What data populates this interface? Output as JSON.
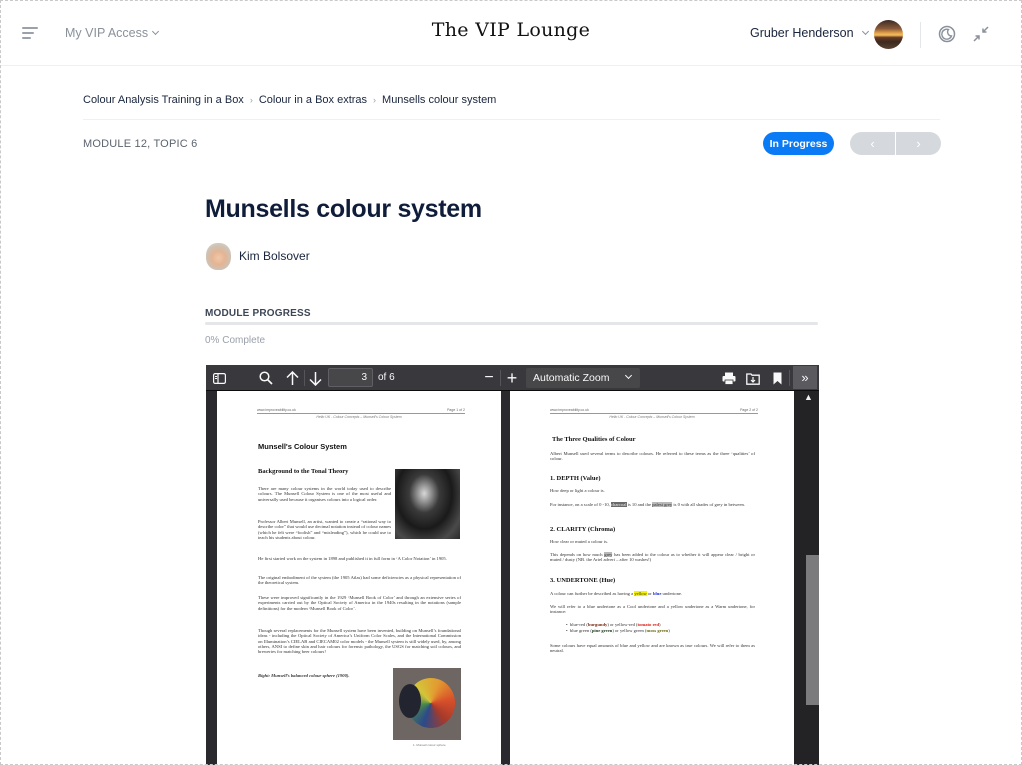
{
  "header": {
    "menu_icon": "hamburger-menu-icon",
    "vip_access_label": "My VIP Access",
    "brand": "The VIP Lounge",
    "user_name": "Gruber Henderson",
    "theme_icon": "moon-icon",
    "collapse_icon": "collapse-arrows-icon"
  },
  "breadcrumb": [
    {
      "label": "Colour Analysis Training in a Box"
    },
    {
      "label": "Colour in a Box extras"
    },
    {
      "label": "Munsells colour system"
    }
  ],
  "breadcrumb_separator": "›",
  "module_topic": "MODULE 12, TOPIC 6",
  "status": {
    "label": "In Progress",
    "color": "#0a7bf5"
  },
  "pager": {
    "prev": "‹",
    "next": "›"
  },
  "page": {
    "title": "Munsells colour system",
    "author": "Kim Bolsover"
  },
  "progress": {
    "label": "MODULE PROGRESS",
    "percent": 0,
    "text": "0% Complete"
  },
  "pdf_viewer": {
    "toolbar": {
      "sidebar_icon": "sidebar-toggle-icon",
      "search_icon": "search-icon",
      "prev_icon": "arrow-up-icon",
      "next_icon": "arrow-down-icon",
      "current_page": "3",
      "page_count_text": "of 6",
      "zoom_out": "−",
      "zoom_in": "+",
      "zoom_value": "Automatic Zoom",
      "print_icon": "print-icon",
      "open_icon": "open-file-icon",
      "bookmark_icon": "bookmark-icon",
      "more_tools": "»"
    },
    "pages": [
      {
        "header_left": "www.improveability.co.uk",
        "header_right": "Page 1 of 2",
        "subheader": "Hello UK - Colour Concepts – Munsell's Colour System",
        "title": "Munsell's Colour System",
        "heading": "Background to the Tonal Theory",
        "paragraphs": [
          "There are many colour systems in the world today used to describe colours. The Munsell Colour System is one of the most useful and universally used because it organises colours into a logical order.",
          "Professor Albert Munsell, an artist, wanted to create a “rational way to describe color” that would use decimal notation instead of colour names (which he felt were “foolish” and “misleading”), which he could use to teach his students about colour.",
          "He first started work on the system in 1898 and published it in full form in ‘A Color Notation’ in 1905.",
          "The original embodiment of the system (the 1905 Atlas) had some deficiencies as a physical representation of the theoretical system.",
          "These were improved significantly in the 1929 ‘Munsell Book of Color’ and through an extensive series of experiments carried out by the Optical Society of America in the 1940s resulting in the notations (sample definitions) for the modern ‘Munsell Book of Color’.",
          "Though several replacements for the Munsell system have been invented, building on Munsell’s foundational ideas - including the Optical Society of America’s Uniform Color Scales, and the International Commission on Illumination’s CIELAB and CIECAM02 color models - the Munsell system is still widely used, by, among others, ANSI to define skin and hair colours for forensic pathology, the USGS for matching soil colours, and breweries for matching beer colours!"
        ],
        "caption_right": "Right: Munsell’s balanced colour sphere (1900).",
        "image_caption": "1. Munsell colour sphere"
      },
      {
        "header_left": "www.improveability.co.uk",
        "header_right": "Page 2 of 2",
        "subheader": "Hello UK - Colour Concepts – Munsell's Colour System",
        "title": "The Three Qualities of Colour",
        "intro": "Albert Munsell used several terms to describe colours. He referred to these terms as the three ‘qualities’ of colour.",
        "sections": [
          {
            "heading": "1. DEPTH (Value)",
            "line1": "How deep or light a colour is.",
            "line2_a": "For instance, on a scale of 0 -10, ",
            "line2_hl1": "charcoal",
            "line2_b": " is 10 and the ",
            "line2_hl2": "palest grey",
            "line2_c": " is 0 with all shades of grey in between."
          },
          {
            "heading": "2. CLARITY (Chroma)",
            "line1": "How clear or muted a colour is.",
            "line2_a": "This depends on how much ",
            "line2_hl1": "grey",
            "line2_b": " has been added to the colour as to whether it will appear clear / bright or muted / dusty (NB. the Ariel advert – after 10 washes!)"
          },
          {
            "heading": "3. UNDERTONE (Hue)",
            "line1_a": "A colour can further be described as having a ",
            "line1_yellow": "yellow",
            "line1_b": " or ",
            "line1_blue": "blue",
            "line1_c": " undertone.",
            "line2": "We will refer to a blue undertone as a Cool undertone and a yellow undertone as a Warm undertone, for instance:",
            "bullets": [
              {
                "a": "blue-red (",
                "b": "burgundy",
                "c": ") or yellow-red (",
                "d": "tomato red",
                "e": ")"
              },
              {
                "a": "blue green (",
                "b": "pine green",
                "c": ") or yellow green (",
                "d": "moss green",
                "e": ")"
              }
            ],
            "closing": "Some colours have equal amounts of blue and yellow and are known as true colours. We will refer to them as neutral."
          }
        ]
      }
    ]
  }
}
